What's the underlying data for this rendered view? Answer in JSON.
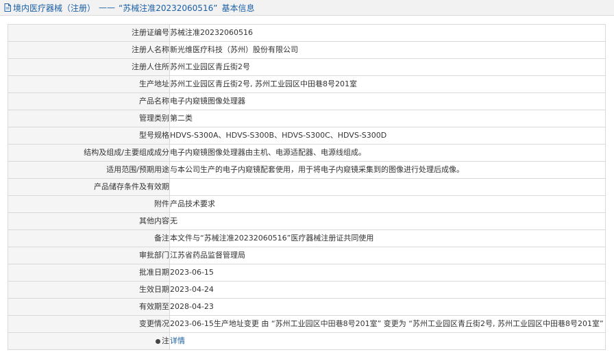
{
  "header": {
    "breadcrumb_category": "境内医疗器械（注册）",
    "separator": "——",
    "record_title": "“苏械注准20232060516”",
    "suffix": "基本信息"
  },
  "rows": [
    {
      "label": "注册证编号",
      "value": "苏械注准20232060516"
    },
    {
      "label": "注册人名称",
      "value": "新光维医疗科技（苏州）股份有限公司"
    },
    {
      "label": "注册人住所",
      "value": "苏州工业园区青丘街2号"
    },
    {
      "label": "生产地址",
      "value": "苏州工业园区青丘街2号, 苏州工业园区中田巷8号201室"
    },
    {
      "label": "产品名称",
      "value": "电子内窥镜图像处理器"
    },
    {
      "label": "管理类别",
      "value": "第二类"
    },
    {
      "label": "型号规格",
      "value": "HDVS-S300A、HDVS-S300B、HDVS-S300C、HDVS-S300D"
    },
    {
      "label": "结构及组成/主要组成成分",
      "value": "电子内窥镜图像处理器由主机、电源适配器、电源线组成。"
    },
    {
      "label": "适用范围/预期用途",
      "value": "与本公司生产的电子内窥镜配套使用，用于将电子内窥镜采集到的图像进行处理后成像。"
    },
    {
      "label": "产品储存条件及有效期",
      "value": ""
    },
    {
      "label": "附件",
      "value": "产品技术要求"
    },
    {
      "label": "其他内容",
      "value": "无"
    },
    {
      "label": "备注",
      "value": "本文件与“苏械注准20232060516”医疗器械注册证共同使用"
    },
    {
      "label": "审批部门",
      "value": "江苏省药品监督管理局"
    },
    {
      "label": "批准日期",
      "value": "2023-06-15"
    },
    {
      "label": "生效日期",
      "value": "2023-04-24"
    },
    {
      "label": "有效期至",
      "value": "2028-04-23"
    },
    {
      "label": "变更情况",
      "value": "2023-06-15生产地址变更 由 “苏州工业园区中田巷8号201室” 变更为 “苏州工业园区青丘街2号, 苏州工业园区中田巷8号201室”"
    }
  ],
  "note_row": {
    "label": "注",
    "link_text": "详情"
  },
  "colors": {
    "accent": "#1a5fa6",
    "label_bg": "#f5f5f5",
    "border": "#d9d9d9"
  },
  "icons": {
    "header": "document-icon",
    "note": "bullet-icon"
  }
}
